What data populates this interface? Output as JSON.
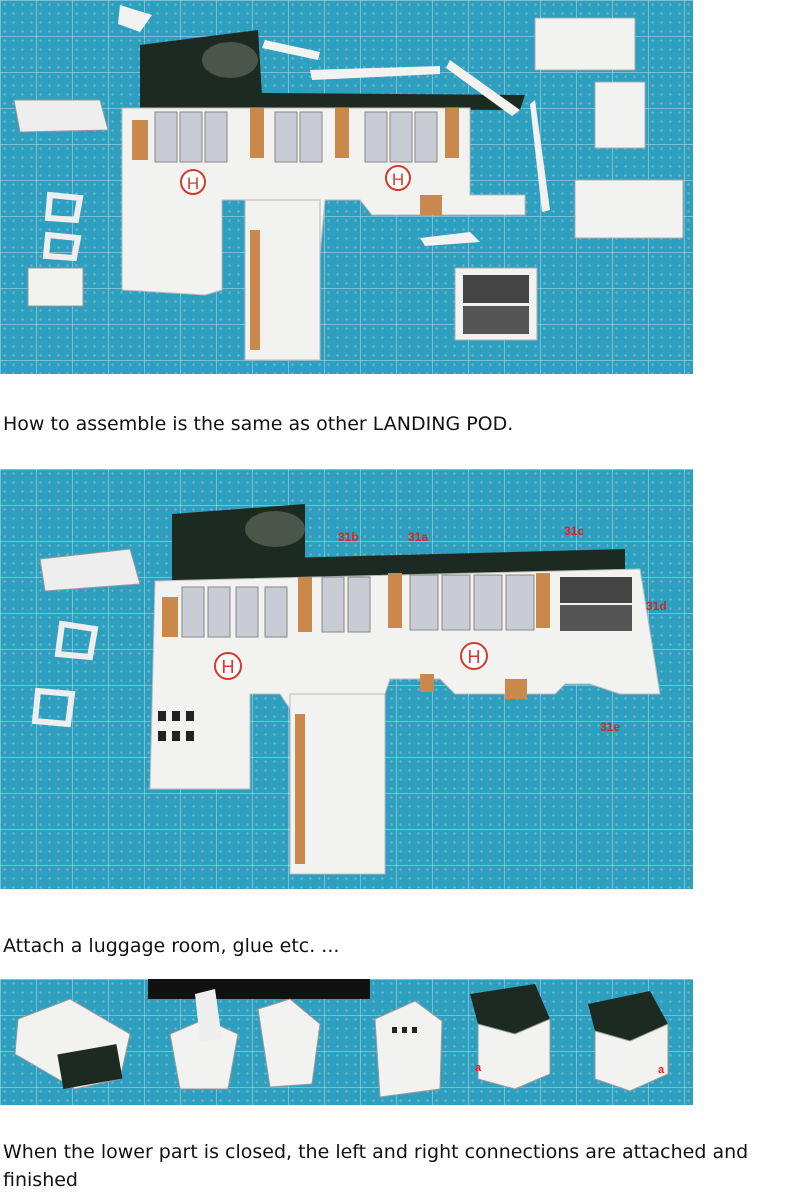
{
  "document": {
    "captions": [
      "How to assemble is the same as other LANDING POD.",
      "Attach a luggage room, glue etc. ...",
      "When the lower part is closed, the left and right connections are attached and finished"
    ],
    "photo_labels": {
      "photo1_heli_marks": [
        "H",
        "H"
      ],
      "photo2_heli_marks": [
        "H",
        "H"
      ],
      "photo2_part_labels": [
        "31b",
        "31a",
        "31c",
        "31d",
        "31e"
      ],
      "photo3_marks": [
        "a",
        "a"
      ]
    }
  },
  "colors": {
    "mat": "#2f9fbf",
    "paper": "#f2f2f0",
    "dark_roof": "#1d2a22",
    "tan_panel": "#c8894a",
    "heli_red": "#d33a2c",
    "label_red": "#e02020"
  }
}
